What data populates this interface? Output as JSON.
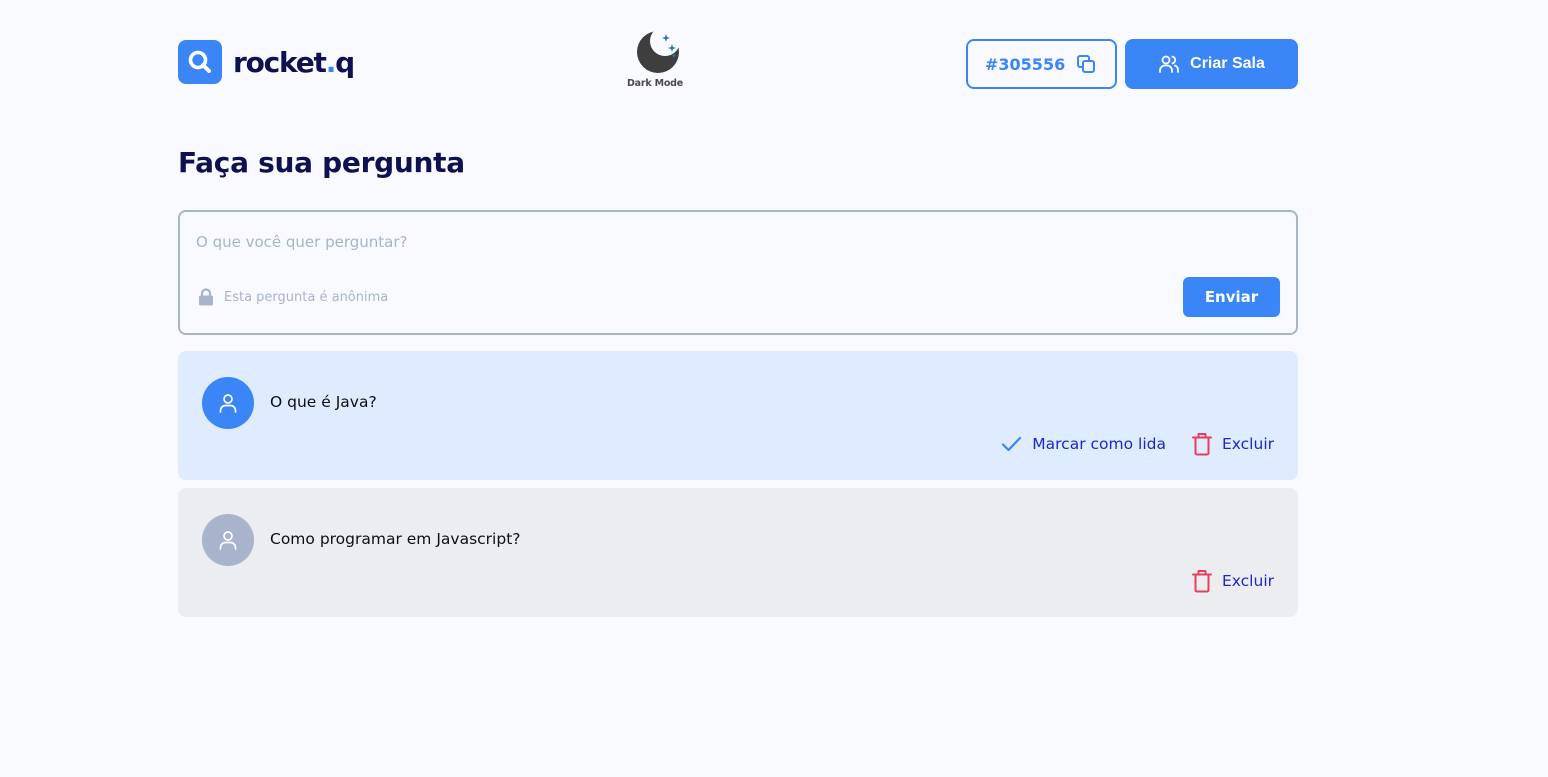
{
  "header": {
    "logo": {
      "name": "rocket",
      "dot": ".",
      "suffix": "q",
      "icon": "magnifier-logo-icon"
    },
    "dark_mode": {
      "label": "Dark Mode",
      "icon": "moon-stars-icon"
    },
    "room_code": {
      "label": "#305556",
      "icon": "copy-icon"
    },
    "create_room": {
      "label": "Criar Sala",
      "icon": "users-icon"
    }
  },
  "main": {
    "title": "Faça sua pergunta",
    "form": {
      "placeholder": "O que você quer perguntar?",
      "anonymous_note": "Esta pergunta é anônima",
      "anonymous_icon": "lock-icon",
      "submit_label": "Enviar"
    },
    "questions": [
      {
        "text": "O que é Java?",
        "state": "unread",
        "mark_read_label": "Marcar como lida",
        "delete_label": "Excluir"
      },
      {
        "text": "Como programar em Javascript?",
        "state": "read",
        "delete_label": "Excluir"
      }
    ]
  },
  "colors": {
    "primary": "#3A86F7",
    "title": "#0D114F",
    "unread_card": "#DFEBFE",
    "read_card": "#EBEDF1",
    "danger": "#E73F5D",
    "action_text": "#1D27C9",
    "background": "#F8FAFF"
  }
}
